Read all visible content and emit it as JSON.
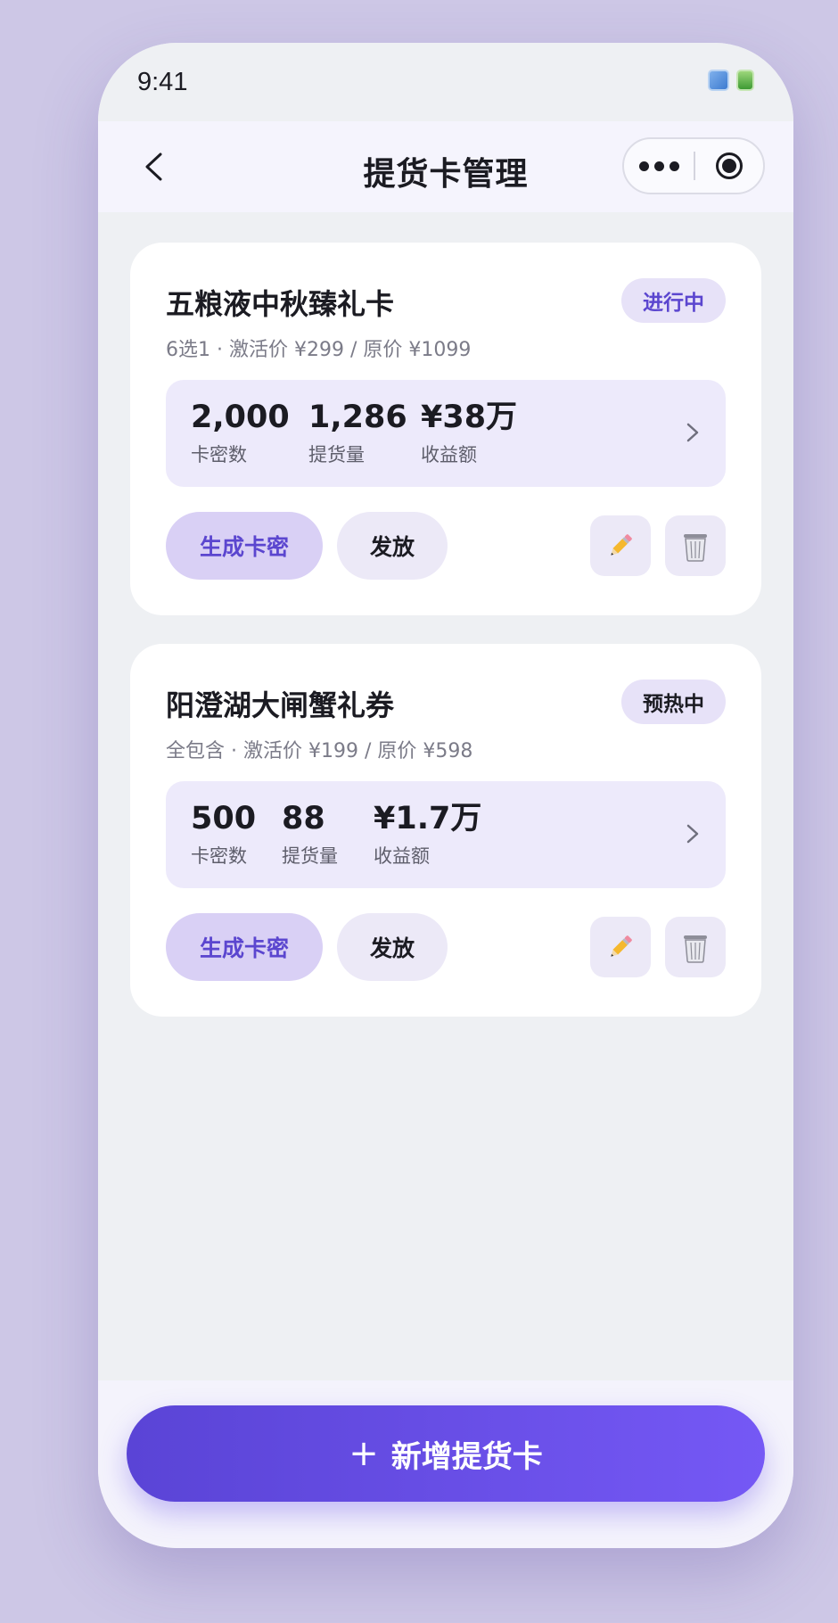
{
  "status_bar": {
    "time": "9:41",
    "icons": [
      "signal-icon",
      "battery-icon"
    ]
  },
  "nav": {
    "title": "提货卡管理",
    "back_icon": "chevron-left-icon",
    "more_icon": "more-dots-icon",
    "close_icon": "record-circle-icon"
  },
  "cards": [
    {
      "title": "五粮液中秋臻礼卡",
      "status": "进行中",
      "status_color": "#5b46cf",
      "subtitle": "6选1 · 激活价 ¥299 / 原价 ¥1099",
      "stats": [
        {
          "value": "2,000",
          "label": "卡密数"
        },
        {
          "value": "1,286",
          "label": "提货量"
        },
        {
          "value": "¥38万",
          "label": "收益额"
        }
      ],
      "primary_action": "生成卡密",
      "secondary_action": "发放"
    },
    {
      "title": "阳澄湖大闸蟹礼券",
      "status": "预热中",
      "status_color": "#1b1b22",
      "subtitle": "全包含 · 激活价 ¥199 / 原价 ¥598",
      "stats": [
        {
          "value": "500",
          "label": "卡密数"
        },
        {
          "value": "88",
          "label": "提货量"
        },
        {
          "value": "¥1.7万",
          "label": "收益额"
        }
      ],
      "primary_action": "生成卡密",
      "secondary_action": "发放"
    }
  ],
  "add_button": {
    "icon": "plus-icon",
    "label": "新增提货卡"
  },
  "colors": {
    "accent": "#6a54ec",
    "accent_light": "#d9d0f5",
    "background": "#eef0f3"
  }
}
